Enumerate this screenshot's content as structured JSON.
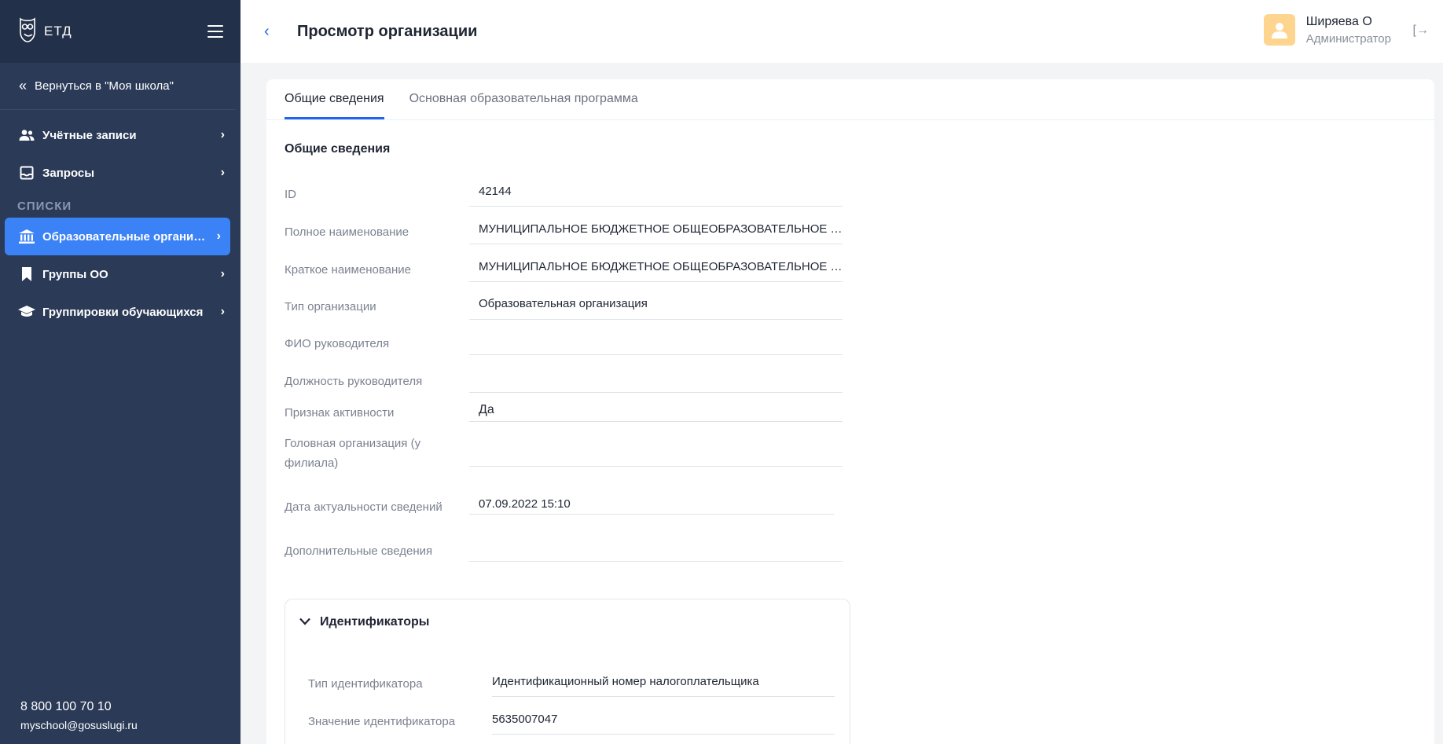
{
  "sidebar": {
    "logo_text": "ЕТД",
    "back_label": "Вернуться в \"Моя школа\"",
    "items_top": [
      {
        "label": "Учётные записи",
        "icon": "users-icon"
      },
      {
        "label": "Запросы",
        "icon": "inbox-icon"
      }
    ],
    "section_title": "СПИСКИ",
    "items_lists": [
      {
        "label": "Образовательные организа...",
        "icon": "institution-icon",
        "active": true
      },
      {
        "label": "Группы ОО",
        "icon": "bookmark-icon"
      },
      {
        "label": "Группировки обучающихся",
        "icon": "graduation-cap-icon"
      }
    ],
    "phone": "8 800 100 70 10",
    "email": "myschool@gosuslugi.ru"
  },
  "header": {
    "title": "Просмотр организации",
    "user_name": "Ширяева О",
    "user_role": "Администратор"
  },
  "tabs": [
    {
      "label": "Общие сведения",
      "active": true
    },
    {
      "label": "Основная образовательная программа",
      "active": false
    }
  ],
  "general": {
    "heading": "Общие сведения",
    "fields": [
      {
        "label": "ID",
        "value": "42144"
      },
      {
        "label": "Полное наименование",
        "value": "МУНИЦИПАЛЬНОЕ БЮДЖЕТНОЕ ОБЩЕОБРАЗОВАТЕЛЬНОЕ УЧ..."
      },
      {
        "label": "Краткое наименование",
        "value": "МУНИЦИПАЛЬНОЕ БЮДЖЕТНОЕ ОБЩЕОБРАЗОВАТЕЛЬНОЕ УЧ..."
      },
      {
        "label": "Тип организации",
        "value": "Образовательная организация"
      },
      {
        "label": "ФИО руководителя",
        "value": ""
      },
      {
        "label": "Должность руководителя",
        "value": ""
      },
      {
        "label": "Признак активности",
        "value": "Да"
      },
      {
        "label": "Головная организация (у филиала)",
        "value": ""
      },
      {
        "label": "Дата актуальности сведений",
        "value": "07.09.2022 15:10"
      },
      {
        "label": "Дополнительные сведения",
        "value": ""
      }
    ]
  },
  "identifiers": {
    "heading": "Идентификаторы",
    "fields": [
      {
        "label": "Тип идентификатора",
        "value": "Идентификационный номер налогоплательщика"
      },
      {
        "label": "Значение идентификатора",
        "value": "5635007047"
      }
    ]
  },
  "colors": {
    "sidebar_bg": "#2b3a57",
    "active_item": "#3b82f6",
    "accent": "#2563eb",
    "avatar_bg": "#fdd58e"
  }
}
